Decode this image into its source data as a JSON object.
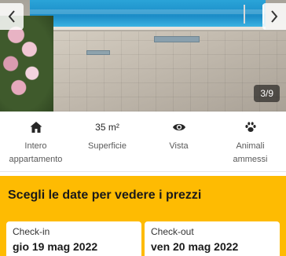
{
  "gallery": {
    "counter": "3/9",
    "prev_icon": "chevron-left-icon",
    "next_icon": "chevron-right-icon"
  },
  "features": [
    {
      "icon": "home-icon",
      "value": "",
      "label": "Intero appartamento"
    },
    {
      "icon": "area-icon",
      "value": "35 m²",
      "label": "Superficie"
    },
    {
      "icon": "eye-icon",
      "value": "",
      "label": "Vista"
    },
    {
      "icon": "paw-icon",
      "value": "",
      "label": "Animali ammessi"
    }
  ],
  "dates": {
    "title": "Scegli le date per vedere i prezzi",
    "checkin_label": "Check-in",
    "checkin_value": "gio 19 mag 2022",
    "checkout_label": "Check-out",
    "checkout_value": "ven 20 mag 2022",
    "background": "#febb02"
  }
}
